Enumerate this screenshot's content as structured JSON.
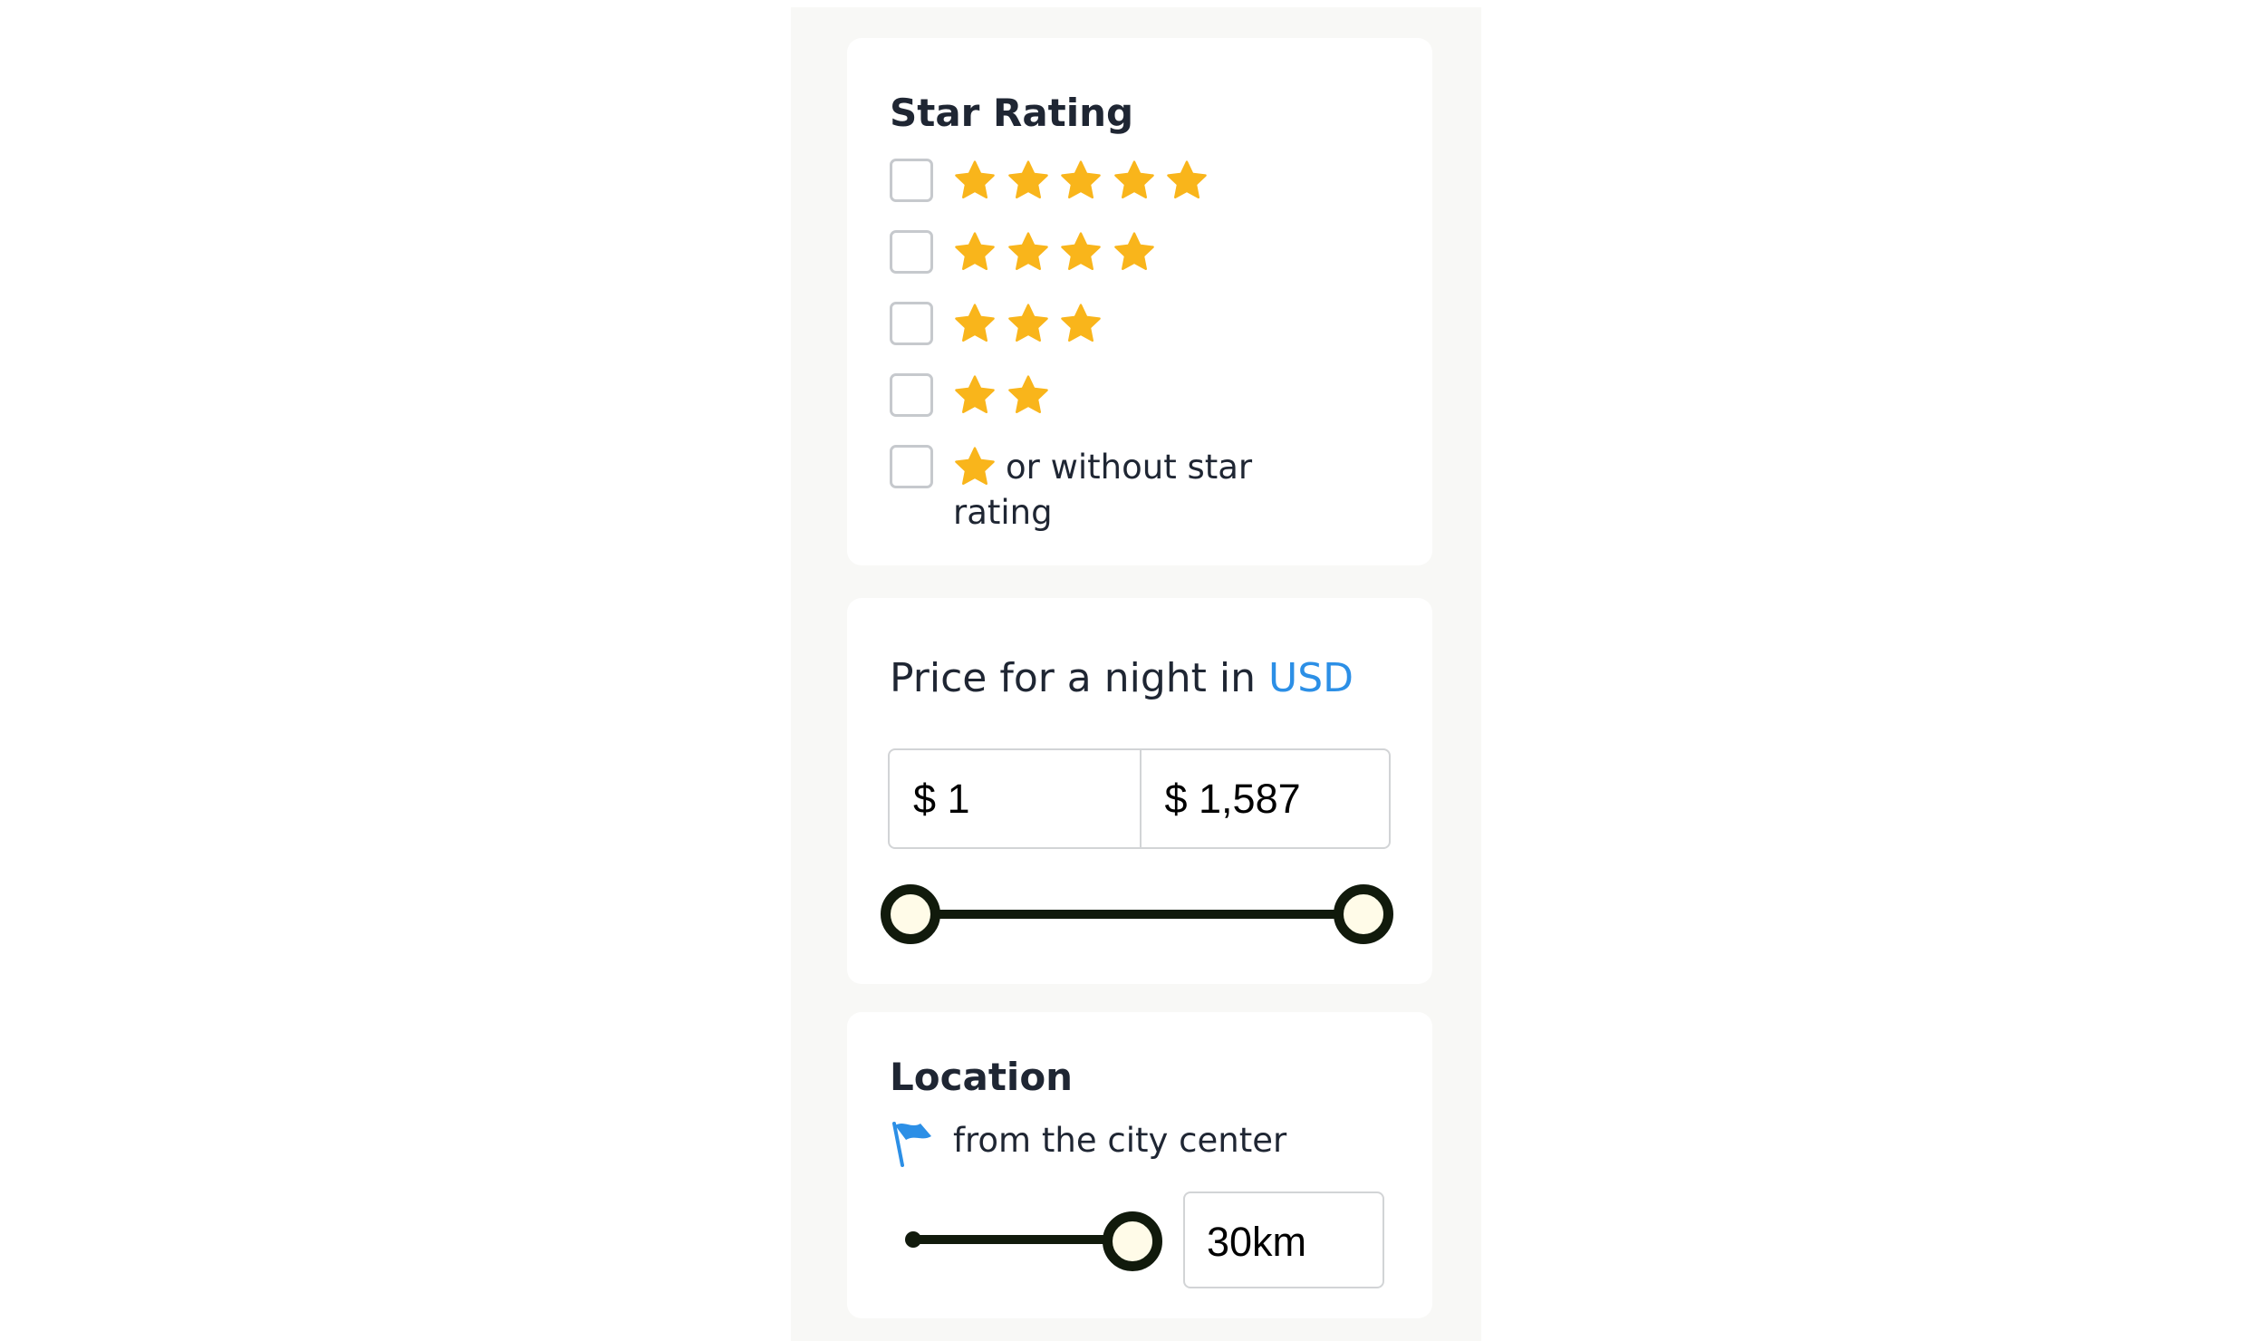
{
  "star_rating": {
    "title": "Star Rating",
    "options": [
      {
        "stars": 5,
        "checked": false
      },
      {
        "stars": 4,
        "checked": false
      },
      {
        "stars": 3,
        "checked": false
      },
      {
        "stars": 2,
        "checked": false
      },
      {
        "stars": 1,
        "checked": false,
        "label": "or without star rating"
      }
    ],
    "star_color": "#f9b51b"
  },
  "price": {
    "title_prefix": "Price for a night in",
    "currency_link": "USD",
    "min_value": "$ 1",
    "max_value": "$ 1,587",
    "range_min_fraction": 0,
    "range_max_fraction": 1
  },
  "location": {
    "title": "Location",
    "flag_icon": "flag-icon",
    "label": "from the city center",
    "distance_value": "30km",
    "slider_fraction": 1
  },
  "colors": {
    "accent": "#2c8fe6",
    "slider": "#111a0c",
    "star": "#f9b51b"
  }
}
